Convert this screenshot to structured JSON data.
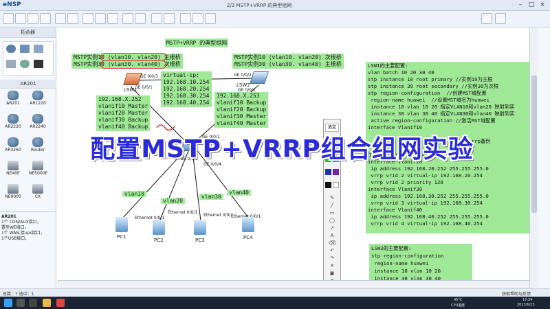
{
  "window": {
    "app_name": "eNSP",
    "title": "2/3 MSTP+VRRP 的典型组网",
    "controls": [
      "–",
      "□",
      "×"
    ]
  },
  "sidebar": {
    "section_title": "拓合器",
    "router_group": "AR201",
    "devices": [
      {
        "label": "AR201",
        "icon": "router-icon"
      },
      {
        "label": "AR1220",
        "icon": "router-icon"
      },
      {
        "label": "AR2220",
        "icon": "router-icon"
      },
      {
        "label": "AR2240",
        "icon": "router-icon"
      },
      {
        "label": "AR3260",
        "icon": "router-icon"
      },
      {
        "label": "Router",
        "icon": "router-icon"
      },
      {
        "label": "NE40E",
        "icon": "router-icon"
      },
      {
        "label": "NE5000E",
        "icon": "router-icon"
      },
      {
        "label": "NE9000",
        "icon": "router-icon"
      },
      {
        "label": "CX",
        "icon": "router-icon"
      }
    ],
    "info_title": "AR201",
    "info_lines": [
      "1个 CON/AUX接口，",
      "置至WE接口，",
      "1个 WAN,接ups接口，",
      "1个USB接口。"
    ]
  },
  "canvas": {
    "title": "MSTP+VRRP 的典型组网",
    "lsw1_note": [
      "MSTP实例10 (vlan10. vlan20) 主根桥",
      "MSTP实例30 (vlan30. vlan40) 次根桥"
    ],
    "lsw2_note": [
      "MSTP实例10 (vlan10. vlan20) 次根桥",
      "MSTP实例30 (vlan30. vlan40) 主根桥"
    ],
    "vip_title": "virtual-ip:",
    "vips": [
      "192.168.10.254",
      "192.168.20.254",
      "192.168.30.254",
      "192.168.40.254"
    ],
    "lsw1_addr": "192.168.X.252",
    "lsw1_roles": [
      "vlanif10 Master",
      "vlanif20 Master",
      "vlanif30 Backup",
      "vlanif40 Backup"
    ],
    "lsw2_addr": "192.168.X.253",
    "lsw2_roles": [
      "vlanif10 Backup",
      "vlanif20 Backup",
      "vlanif30 Master",
      "vlanif40 Master"
    ],
    "nodes": {
      "lsw1": "LSW1",
      "lsw2": "LSW2",
      "lsw3": "LSW3",
      "pc1": "PC1",
      "pc2": "PC2",
      "pc3": "PC3",
      "pc4": "PC4"
    },
    "port_labels": {
      "lsw1_a": "GE 0/0/3",
      "lsw1_b": "GE 0/0/1",
      "lsw2_a": "GE 0/0/2",
      "lsw2_b": "GE 0/0/1",
      "lsw3_a": "GE 0/0/2",
      "lsw3_b": "GE 0/0/3",
      "lsw3_c": "GE 0/0/4",
      "lsw3_d": "GE 0/0/1",
      "e1": "Ethernet 0/0/1",
      "e2": "Ethernet 0/0/1",
      "e3": "Ethernet 0/0/1",
      "e4": "Ethernet 0/0/1"
    },
    "vlans": [
      "vlan10",
      "vlan20",
      "vlan30",
      "vlan40"
    ]
  },
  "config_panel": {
    "lines": [
      "LSW1的主要配置:",
      "vlan batch 10 20 30 40",
      "stp instance 10 root primary //实例10为主根",
      "stp instance 30 root secondary //实例30为次根",
      "stp region-configuration  //创建MST域配置",
      " region-name huawei  //设置MST域名为huawei",
      " instance 10 vlan 10 20 指定VLAN10和vlan20 映射到实",
      " instance 30 vlan 30 40 指定VLAN30和vlan40 映射到实",
      " active region-configuration //激活MST域配置",
      "interface Vlanif10",
      "",
      "                           .0 配置vrrp备份",
      "                            份组1的",
      "优先级为120为master设备",
      "interface Vlanif20",
      " ip address 192.168.20.252 255.255.255.0",
      " vrrp vrid 2 virtual-ip 192.168.20.254",
      " vrrp vrid 2 priority 120",
      "interface Vlanif30",
      " ip address 192.168.30.252 255.255.255.0",
      " vrrp vrid 3 virtual-ip 192.168.30.254",
      "interface Vlanif40",
      " ip address 192.168.40.252 255.255.255.0",
      " vrrp vrid 4 virtual-ip 192.168.40.254"
    ],
    "lsw3_lines": [
      "LSW3的主要配置:",
      "stp region-configuration",
      " region-name huawei",
      " instance 10 vlan 10 20",
      " instance 30 vlan 30 40"
    ]
  },
  "palette": {
    "select_label": "选定"
  },
  "banner": "配置MSTP+VRRP组合组网实验",
  "statusbar": {
    "left": "总数：7  选中：1",
    "right": "获取帮助与反馈"
  },
  "taskbar": {
    "temp": "45°C",
    "cpu": "CPU温度",
    "time": "17:34",
    "date": "2023/6/25"
  },
  "colors": {
    "highlight": "#9fe896",
    "banner": "#2b2bd6",
    "annotation": "#dd3333"
  }
}
